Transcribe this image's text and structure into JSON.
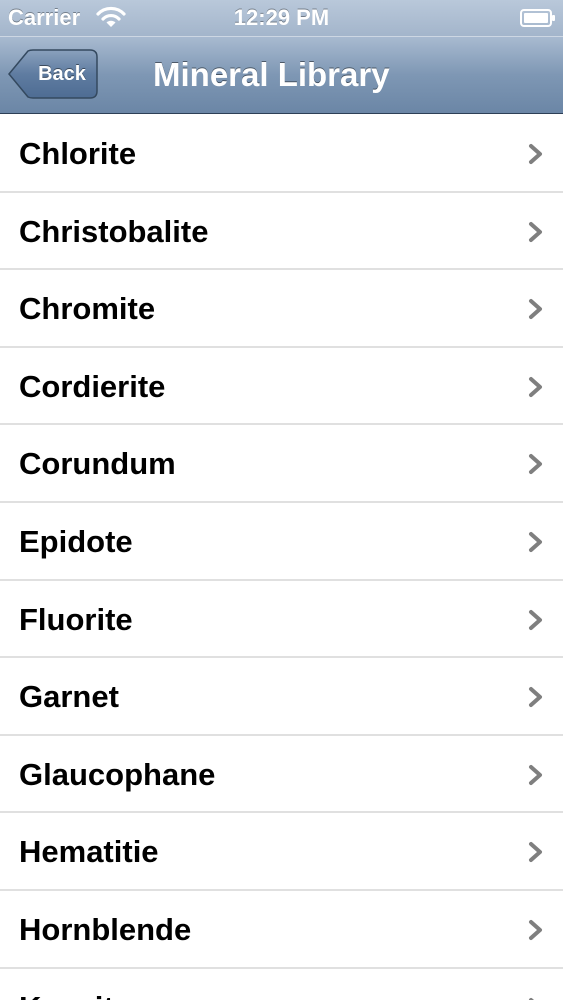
{
  "status_bar": {
    "carrier": "Carrier",
    "time": "12:29 PM"
  },
  "nav_bar": {
    "back_label": "Back",
    "title": "Mineral Library"
  },
  "list": {
    "items": [
      {
        "label": "Chlorite"
      },
      {
        "label": "Christobalite"
      },
      {
        "label": "Chromite"
      },
      {
        "label": "Cordierite"
      },
      {
        "label": "Corundum"
      },
      {
        "label": "Epidote"
      },
      {
        "label": "Fluorite"
      },
      {
        "label": "Garnet"
      },
      {
        "label": "Glaucophane"
      },
      {
        "label": "Hematitie"
      },
      {
        "label": "Hornblende"
      },
      {
        "label": "Kyanite"
      }
    ]
  },
  "icons": {
    "wifi": "wifi-icon",
    "battery": "battery-icon",
    "row_disclosure": "chevron-right-icon"
  },
  "colors": {
    "nav_bar": "#7e97b4",
    "status_bar": "#a3b5cb",
    "chevron": "#7f7f7f",
    "separator": "#e0e0e0"
  }
}
